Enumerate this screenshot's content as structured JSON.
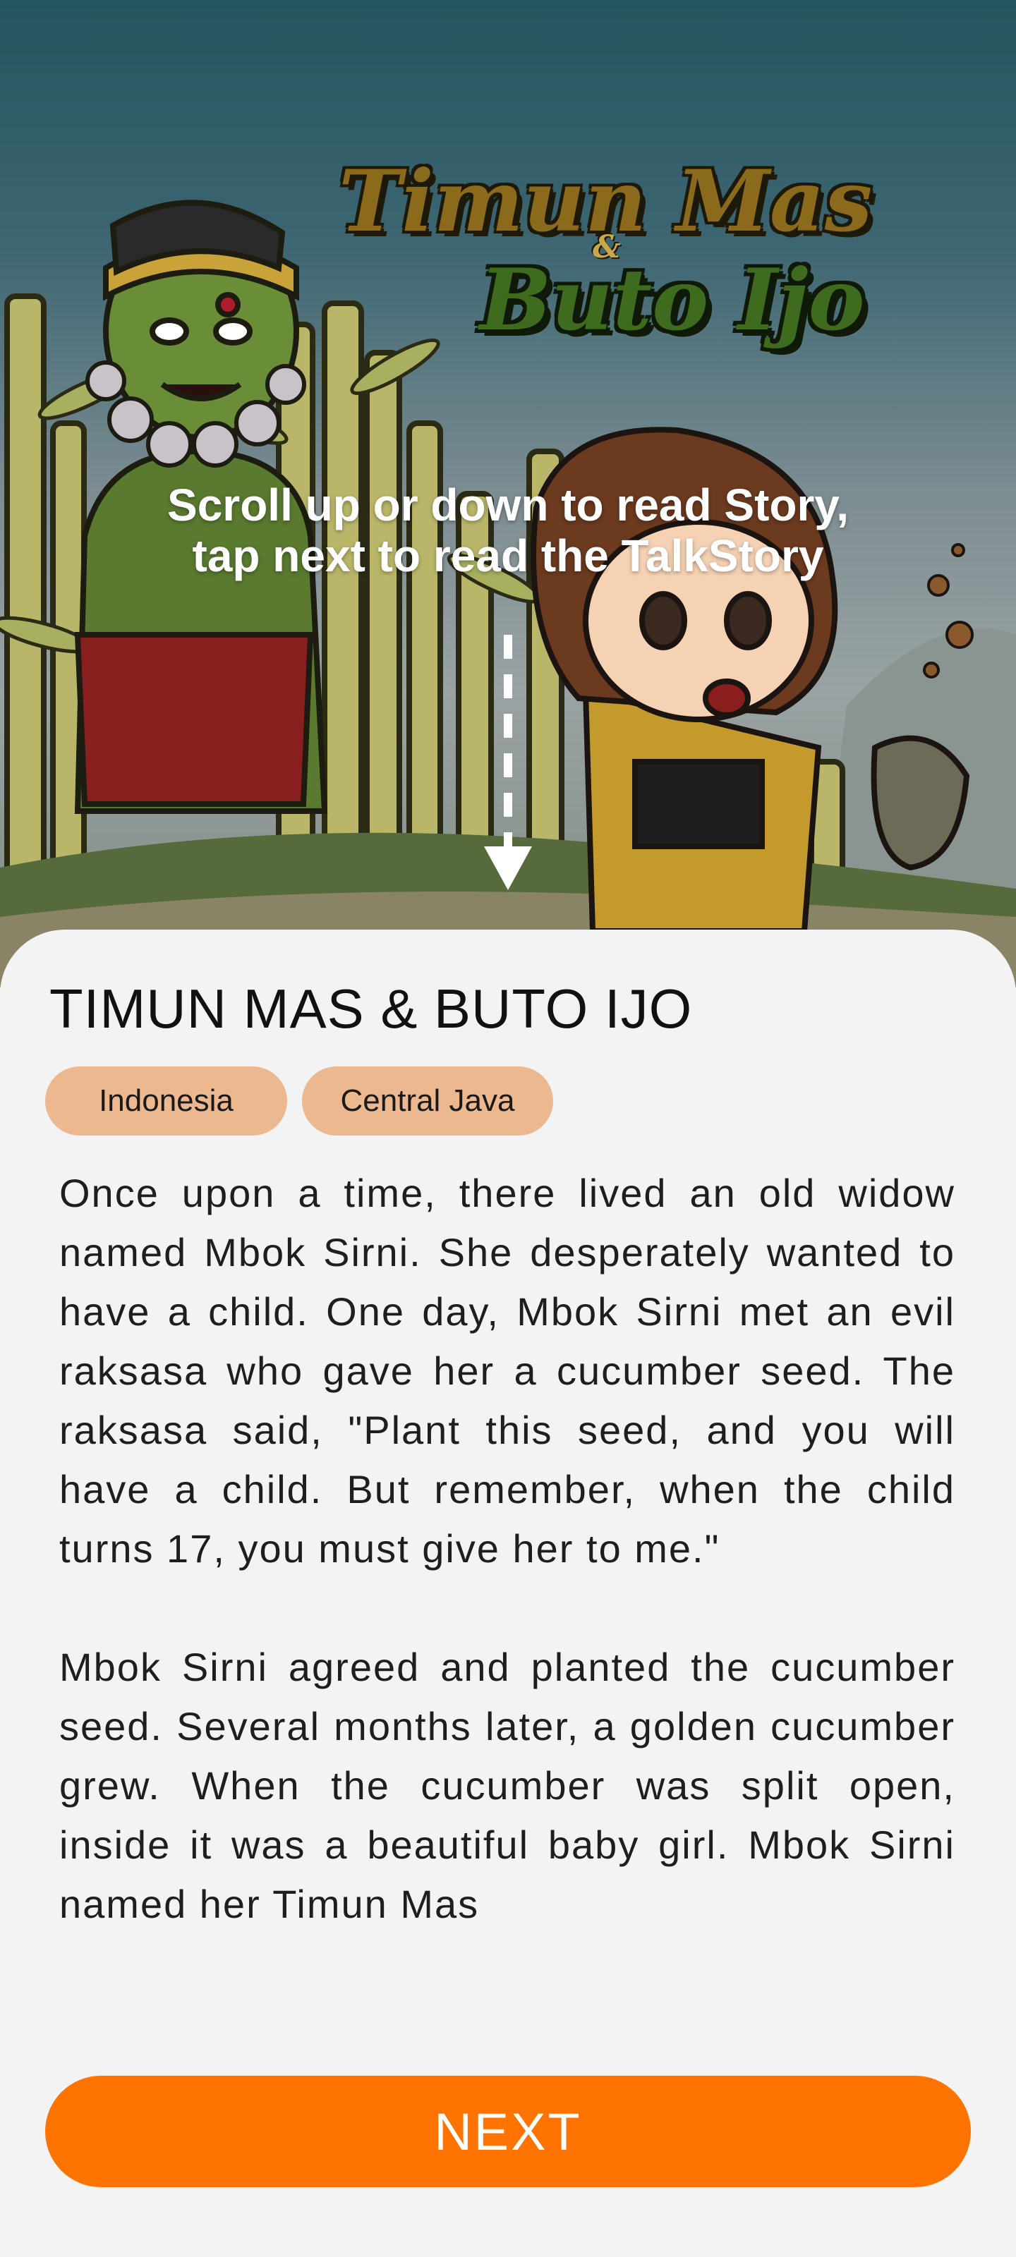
{
  "hero": {
    "logo": {
      "line1": "Timun Mas",
      "ampersand": "&",
      "line2": "Buto Ijo"
    },
    "instruction": {
      "line1": "Scroll up or down to read Story,",
      "line2": "tap next to read the TalkStory"
    },
    "scroll_indicator_icon": "dashed-down-arrow-icon"
  },
  "story": {
    "title": "TIMUN MAS & BUTO IJO",
    "tags": [
      "Indonesia",
      "Central Java"
    ],
    "paragraphs": [
      "Once upon a time, there lived an old widow named Mbok Sirni. She desperately wanted to have a child. One day, Mbok Sirni met an evil raksasa who gave her a cucumber seed. The raksasa said, \"Plant this seed, and you will have a child. But remember, when the child turns 17, you must give her to me.\"",
      "Mbok Sirni agreed and planted the cucumber seed. Several months later, a golden cucumber grew. When the cucumber was split open, inside it was a beautiful baby girl. Mbok Sirni named her Timun Mas"
    ]
  },
  "actions": {
    "next_label": "NEXT"
  },
  "colors": {
    "accent": "#ff7300",
    "tag_background": "#ecb890",
    "sheet_background": "#f3f3f3"
  }
}
